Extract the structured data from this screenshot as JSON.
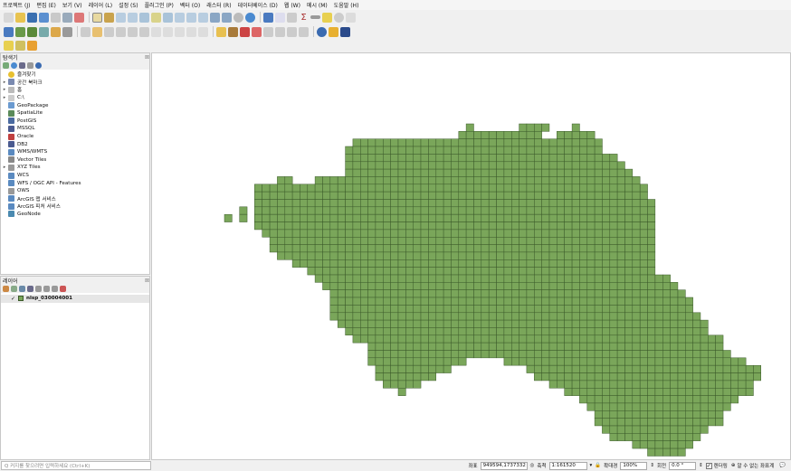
{
  "menu": [
    "프로젝트 (J)",
    "편집 (E)",
    "보기 (V)",
    "레이어 (L)",
    "설정 (S)",
    "플러그인 (P)",
    "벡터 (O)",
    "래스터 (R)",
    "데이터베이스 (D)",
    "웹 (W)",
    "메시 (M)",
    "도움말 (H)"
  ],
  "browser": {
    "title": "탐색기",
    "items": [
      {
        "label": "즐겨찾기",
        "icon": "star-icon",
        "arrow": ""
      },
      {
        "label": "공간 북마크",
        "icon": "bookmark-icon",
        "arrow": "▸"
      },
      {
        "label": "홈",
        "icon": "home-folder-icon",
        "arrow": "▸"
      },
      {
        "label": "C:\\",
        "icon": "drive-icon",
        "arrow": "▸"
      },
      {
        "label": "GeoPackage",
        "icon": "geopackage-icon",
        "arrow": ""
      },
      {
        "label": "SpatiaLite",
        "icon": "spatialite-icon",
        "arrow": ""
      },
      {
        "label": "PostGIS",
        "icon": "postgis-icon",
        "arrow": ""
      },
      {
        "label": "MSSQL",
        "icon": "mssql-icon",
        "arrow": ""
      },
      {
        "label": "Oracle",
        "icon": "oracle-icon",
        "arrow": ""
      },
      {
        "label": "DB2",
        "icon": "db2-icon",
        "arrow": ""
      },
      {
        "label": "WMS/WMTS",
        "icon": "wms-icon",
        "arrow": ""
      },
      {
        "label": "Vector Tiles",
        "icon": "vector-tiles-icon",
        "arrow": ""
      },
      {
        "label": "XYZ Tiles",
        "icon": "xyz-tiles-icon",
        "arrow": "▸"
      },
      {
        "label": "WCS",
        "icon": "wcs-icon",
        "arrow": ""
      },
      {
        "label": "WFS / OGC API - Features",
        "icon": "wfs-icon",
        "arrow": ""
      },
      {
        "label": "OWS",
        "icon": "ows-icon",
        "arrow": ""
      },
      {
        "label": "ArcGIS 맵 서비스",
        "icon": "arcgis-map-icon",
        "arrow": ""
      },
      {
        "label": "ArcGIS 피처 서비스",
        "icon": "arcgis-feature-icon",
        "arrow": ""
      },
      {
        "label": "GeoNode",
        "icon": "geonode-icon",
        "arrow": ""
      }
    ]
  },
  "layers": {
    "title": "레이어",
    "items": [
      {
        "label": "nlsp_030004001",
        "checked": true,
        "color": "#7aa65a"
      }
    ]
  },
  "status": {
    "search_placeholder": "Q 커지를 찾으려면 입력하세요 (Ctrl+K)",
    "coord_label": "좌표",
    "coord_value": "949594,1737332",
    "scale_label": "축척",
    "scale_value": "1:161520",
    "magnifier_label": "확대경",
    "magnifier_value": "100%",
    "rotation_label": "회전",
    "rotation_value": "0.0 °",
    "render_label": "렌더링",
    "crs_label": "알 수 없는 좌표계"
  },
  "colors": {
    "fill": "#7aa65a",
    "stroke": "#3b5a2a",
    "accent": "#2f6fb5"
  }
}
